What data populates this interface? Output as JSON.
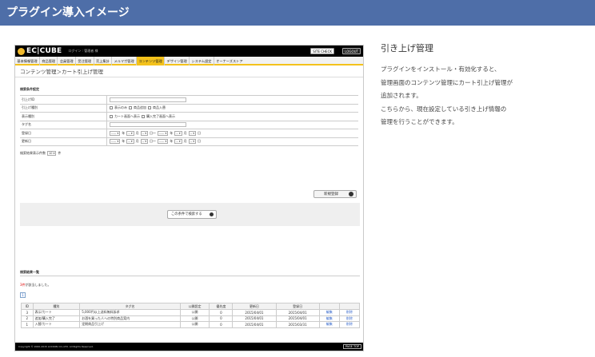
{
  "banner": {
    "title": "プラグイン導入イメージ"
  },
  "admin": {
    "logo_text": "EC|CUBE",
    "login_text": "ログイン : 管理者 様",
    "site_check": "SITE CHECK",
    "logout": "LOGOUT",
    "nav": [
      "基本情報管理",
      "商品管理",
      "会員管理",
      "受注管理",
      "売上集計",
      "メルマガ管理",
      "コンテンツ管理",
      "デザイン管理",
      "システム設定",
      "オーナーズストア"
    ],
    "nav_active_index": 6,
    "breadcrumb": "コンテンツ管理＞カート引上げ管理",
    "search_section": "検索条件設定",
    "fields": [
      {
        "label": "引上げID"
      },
      {
        "label": "引上げ種別",
        "options": [
          "表示のみ",
          "商品追加",
          "商品入替"
        ]
      },
      {
        "label": "表示種別",
        "options": [
          "カート画面へ表示",
          "購入完了画面へ表示"
        ]
      },
      {
        "label": "タグ名"
      },
      {
        "label": "登録日",
        "date": [
          "-----",
          "年",
          "--",
          "月",
          "--",
          "日〜",
          "-----",
          "年",
          "--",
          "月",
          "--",
          "日"
        ]
      },
      {
        "label": "更新日",
        "date": [
          "-----",
          "年",
          "--",
          "月",
          "--",
          "日〜",
          "-----",
          "年",
          "--",
          "月",
          "--",
          "日"
        ]
      }
    ],
    "count_label": "検索結果表示件数",
    "count_value": "10",
    "count_unit": "件",
    "new_button": "新規登録",
    "search_button": "この条件で検索する",
    "results_title": "検索結果一覧",
    "results_count": "3件",
    "results_msg": "が該当しました。",
    "page_number": "1",
    "columns": [
      "ID",
      "種別",
      "タグ名",
      "公開設定",
      "優先度",
      "更新日",
      "登録日",
      "",
      ""
    ],
    "rows": [
      {
        "id": "3",
        "type": "表示/カート",
        "tag": "5,000円以上送料無料訴求",
        "pub": "公開",
        "pri": "0",
        "upd": "2015/04/01",
        "reg": "2015/04/01",
        "edit": "編集",
        "del": "削除"
      },
      {
        "id": "2",
        "type": "追加/購入完了",
        "tag": "お酒を買った人への特別商品案内",
        "pub": "公開",
        "pri": "0",
        "upd": "2015/04/01",
        "reg": "2015/04/01",
        "edit": "編集",
        "del": "削除"
      },
      {
        "id": "1",
        "type": "入替/カート",
        "tag": "定期商品引上げ",
        "pub": "公開",
        "pri": "0",
        "upd": "2015/04/01",
        "reg": "2015/03/31",
        "edit": "編集",
        "del": "削除"
      }
    ],
    "copyright": "Copyright © 2000-2015 LOCKON CO.,LTD. All Rights Reserved.",
    "page_top": "PAGE TOP"
  },
  "side": {
    "title": "引き上げ管理",
    "lines": [
      "プラグインをインストール・有効化すると、",
      "管理画面のコンテンツ管理にカート引上げ管理が",
      "追加されます。",
      "こちらから、現在設定している引き上げ情報の",
      "管理を行うことができます。"
    ]
  }
}
